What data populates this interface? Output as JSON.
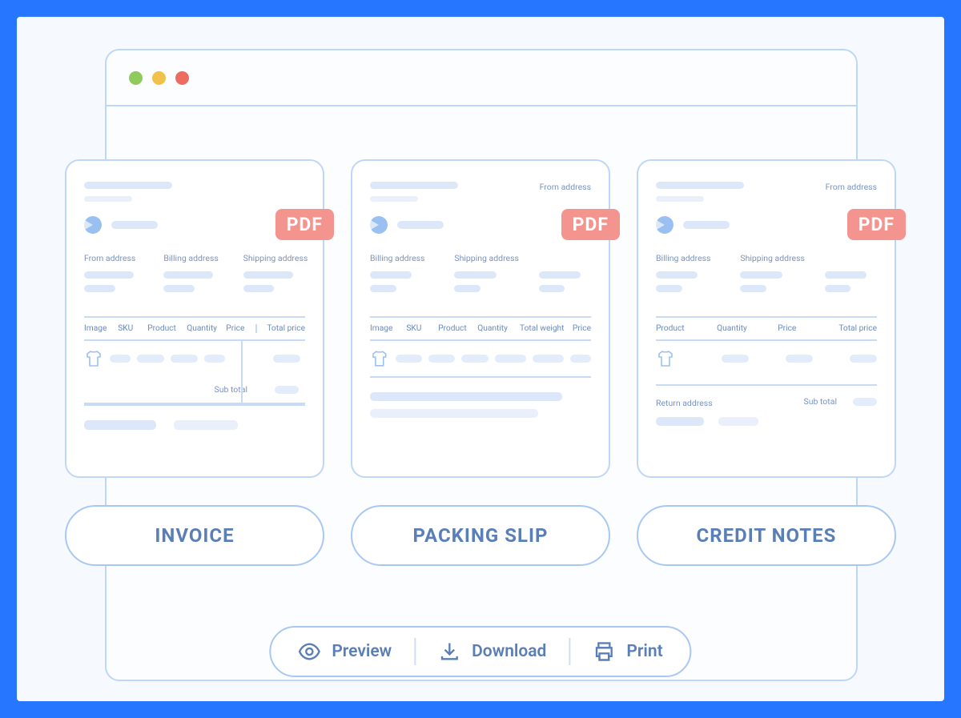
{
  "pdf_label": "PDF",
  "docs": {
    "invoice": {
      "title_button": "INVOICE",
      "addr1": "From address",
      "addr2": "Billing address",
      "addr3": "Shipping address",
      "cols": {
        "image": "Image",
        "sku": "SKU",
        "product": "Product",
        "qty": "Quantity",
        "price": "Price",
        "total": "Total price"
      },
      "subtotal_label": "Sub total"
    },
    "packing": {
      "title_button": "PACKING SLIP",
      "from": "From address",
      "addr1": "Billing address",
      "addr2": "Shipping address",
      "cols": {
        "image": "Image",
        "sku": "SKU",
        "product": "Product",
        "qty": "Quantity",
        "weight": "Total weight",
        "price": "Price"
      }
    },
    "credit": {
      "title_button": "CREDIT NOTES",
      "from": "From address",
      "addr1": "Billing address",
      "addr2": "Shipping address",
      "cols": {
        "product": "Product",
        "qty": "Quantity",
        "price": "Price",
        "total": "Total price"
      },
      "return_label": "Return address",
      "subtotal_label": "Sub total"
    }
  },
  "actions": {
    "preview": "Preview",
    "download": "Download",
    "print": "Print"
  }
}
